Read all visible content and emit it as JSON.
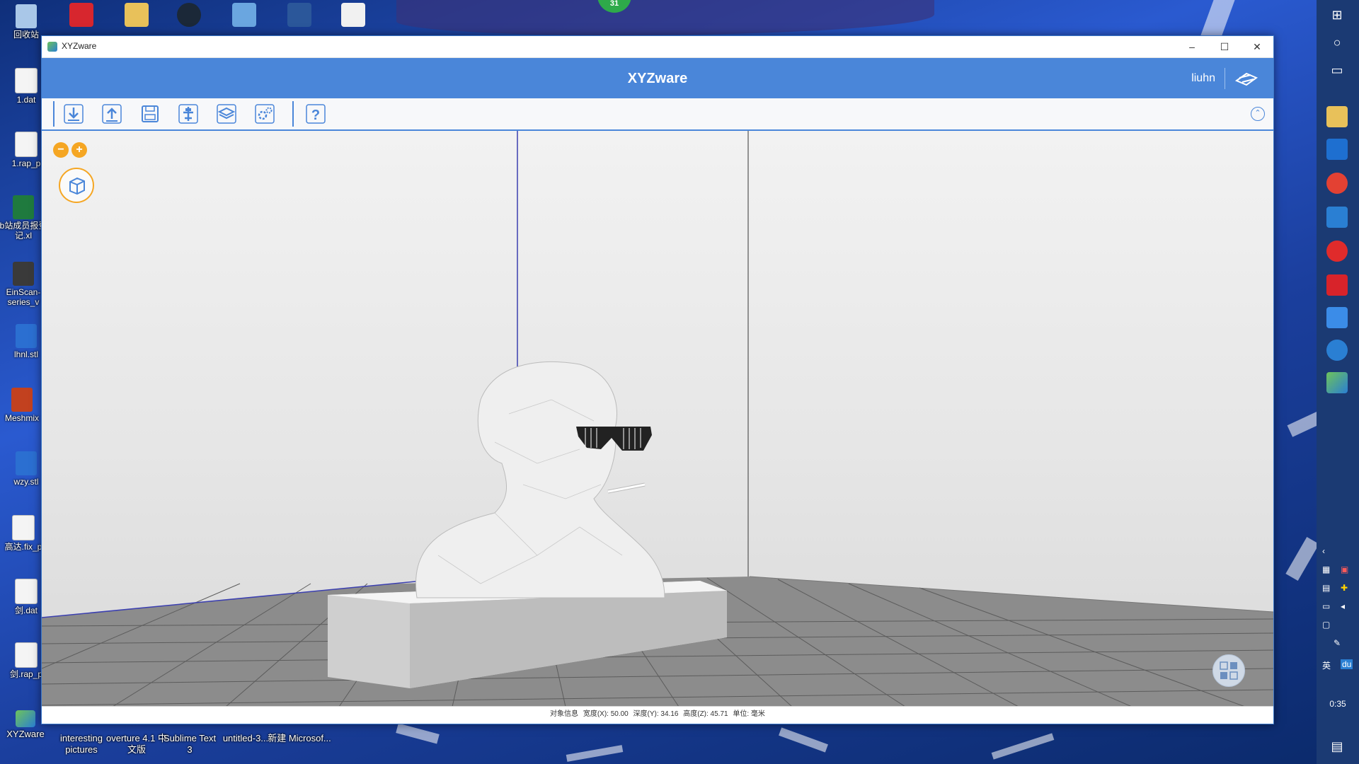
{
  "desktop": {
    "left_icons": [
      {
        "label": "回收站",
        "kind": "recycle"
      },
      {
        "label": "1.dat",
        "kind": "file"
      },
      {
        "label": "1.rap_p",
        "kind": "file"
      },
      {
        "label": "b站成员报登记.xl",
        "kind": "xls"
      },
      {
        "label": "EinScan-series_v",
        "kind": "app"
      },
      {
        "label": "lhnl.stl",
        "kind": "stl"
      },
      {
        "label": "Meshmix",
        "kind": "mesh"
      },
      {
        "label": "wzy.stl",
        "kind": "stl"
      },
      {
        "label": "高达.fix_p",
        "kind": "file"
      },
      {
        "label": "剑.dat",
        "kind": "file"
      },
      {
        "label": "剑.rap_p",
        "kind": "file"
      }
    ],
    "bottom_icons": [
      {
        "label": "XYZware"
      },
      {
        "label": "interesting pictures"
      },
      {
        "label": "overture 4.1 中文版"
      },
      {
        "label": "Sublime Text 3"
      },
      {
        "label": "untitled-3..."
      },
      {
        "label": "新建 Microsof..."
      }
    ],
    "notification_badge": "31"
  },
  "taskbar": {
    "clock": "0:35",
    "ime_label": "英",
    "ime_du": "du"
  },
  "window": {
    "title": "XYZware",
    "controls": {
      "minimize": "–",
      "maximize": "☐",
      "close": "✕"
    },
    "header": {
      "app_name": "XYZware",
      "username": "liuhn"
    },
    "toolbar": {
      "tools": [
        {
          "name": "import",
          "icon": "import-icon"
        },
        {
          "name": "export",
          "icon": "export-icon"
        },
        {
          "name": "save",
          "icon": "save-icon"
        },
        {
          "name": "print",
          "icon": "print-icon"
        },
        {
          "name": "slice",
          "icon": "layers-icon"
        },
        {
          "name": "settings",
          "icon": "gear-icon"
        },
        {
          "name": "help",
          "icon": "help-icon"
        }
      ],
      "collapse_symbol": "⌃"
    },
    "viewport": {
      "zoom_out": "−",
      "zoom_in": "+"
    },
    "status": {
      "label_object_info": "对象信息",
      "width": "宽度(X): 50.00",
      "depth": "深度(Y): 34.16",
      "height": "高度(Z): 45.71",
      "unit": "单位: 毫米"
    }
  },
  "colors": {
    "accent": "#4a86d9",
    "zoom_orange": "#f5a623"
  }
}
